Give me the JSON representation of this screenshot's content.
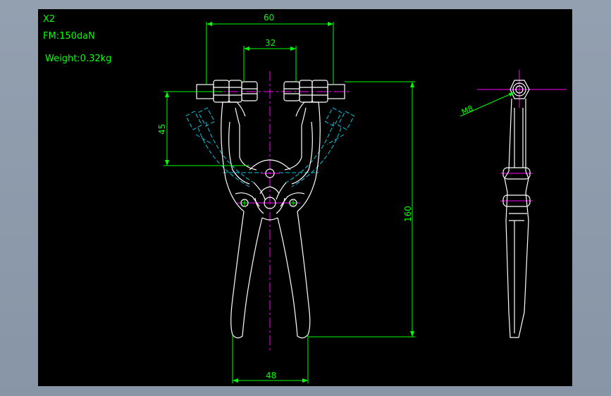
{
  "notes": {
    "quantity": "X2",
    "force": "FM:150daN",
    "weight": "Weight:0.32kg"
  },
  "dimensions": {
    "d60": "60",
    "d32": "32",
    "d45": "45",
    "d160": "160",
    "d48": "48",
    "thread": "M8"
  },
  "colors": {
    "background": "#000000",
    "frame": "#8795a6",
    "outline": "#ffffff",
    "dimension": "#00ff00",
    "centerline": "#ff00ff",
    "hidden": "#00c8e0",
    "text": "#00ff00"
  }
}
